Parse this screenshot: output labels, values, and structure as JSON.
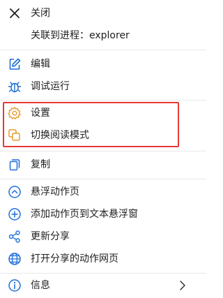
{
  "menu": {
    "close": {
      "label": "关闭",
      "icon": "close-icon"
    },
    "process": {
      "label": "关联到进程：explorer"
    },
    "edit": {
      "label": "编辑",
      "icon": "edit-icon"
    },
    "debug": {
      "label": "调试运行",
      "icon": "bug-icon"
    },
    "settings": {
      "label": "设置",
      "icon": "gear-icon"
    },
    "reading_mode": {
      "label": "切换阅读模式",
      "icon": "reading-mode-icon"
    },
    "copy": {
      "label": "复制",
      "icon": "copy-icon"
    },
    "float_page": {
      "label": "悬浮动作页",
      "icon": "chevron-up-circle-icon"
    },
    "add_text": {
      "label": "添加动作页到文本悬浮窗",
      "icon": "plus-circle-icon"
    },
    "update_share": {
      "label": "更新分享",
      "icon": "share-icon"
    },
    "open_share": {
      "label": "打开分享的动作网页",
      "icon": "globe-icon"
    },
    "info": {
      "label": "信息",
      "icon": "info-icon"
    }
  },
  "colors": {
    "icon_blue": "#1e6fd9",
    "icon_orange": "#e89b2e",
    "highlight_red": "#e53935",
    "divider": "#e8e8e8"
  }
}
